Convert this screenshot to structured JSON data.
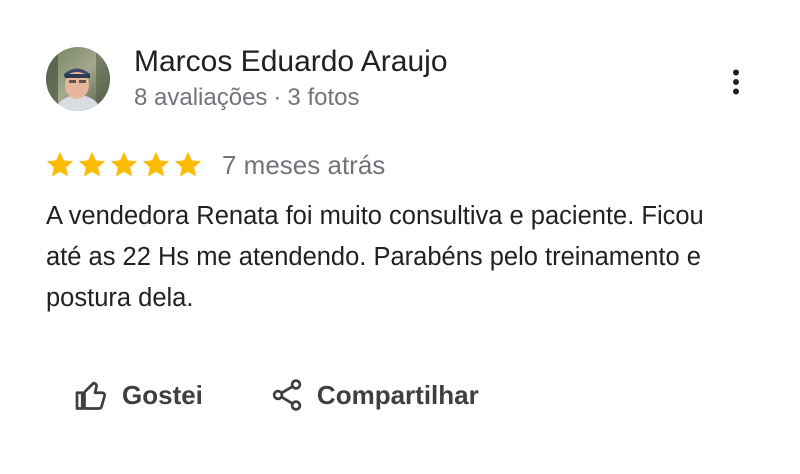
{
  "reviewer": {
    "name": "Marcos Eduardo Araujo",
    "reviews_count": "8 avaliações",
    "separator": "·",
    "photos_count": "3 fotos"
  },
  "rating": {
    "stars": 5,
    "max_stars": 5,
    "star_color": "#fbbc04",
    "date": "7 meses atrás"
  },
  "review": {
    "text": "A vendedora Renata foi muito consultiva e paciente. Ficou até as 22 Hs me atendendo. Parabéns pelo treinamento e postura dela."
  },
  "actions": {
    "like_label": "Gostei",
    "like_icon": "thumb-up-icon",
    "share_label": "Compartilhar",
    "share_icon": "share-icon"
  },
  "menu": {
    "icon": "more-vert-icon"
  }
}
